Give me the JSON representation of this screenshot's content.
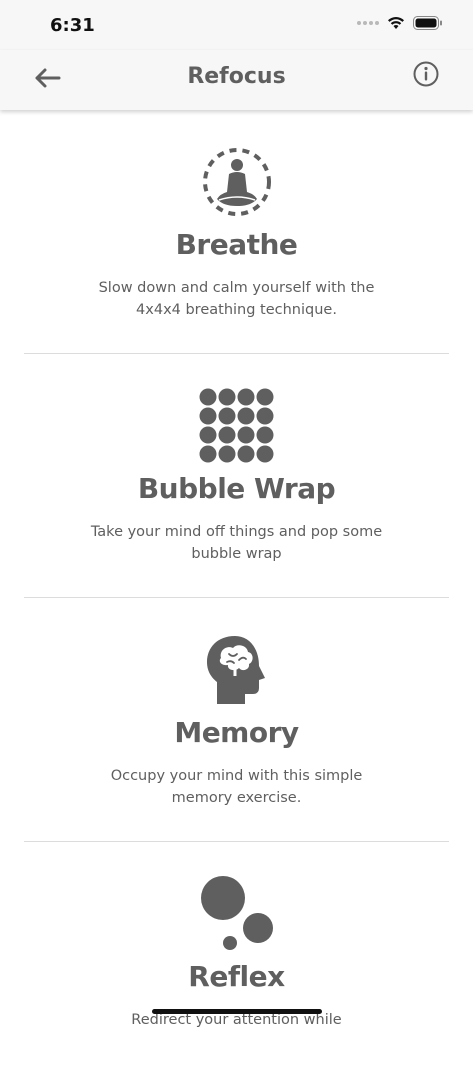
{
  "status": {
    "time": "6:31"
  },
  "nav": {
    "title": "Refocus",
    "back_icon": "arrow-left-icon",
    "info_icon": "info-circle-icon"
  },
  "activities": [
    {
      "title": "Breathe",
      "description": "Slow down and calm yourself with the 4x4x4 breathing technique.",
      "icon": "meditation-icon"
    },
    {
      "title": "Bubble Wrap",
      "description": "Take your mind off things and pop some bubble wrap",
      "icon": "bubble-grid-icon"
    },
    {
      "title": "Memory",
      "description": "Occupy your mind with this simple memory exercise.",
      "icon": "brain-head-icon"
    },
    {
      "title": "Reflex",
      "description": "Redirect your attention while",
      "icon": "reflex-circles-icon"
    }
  ],
  "colors": {
    "text": "#5f5f5f",
    "bar": "#f7f7f7",
    "divider": "#dcdcdc"
  }
}
